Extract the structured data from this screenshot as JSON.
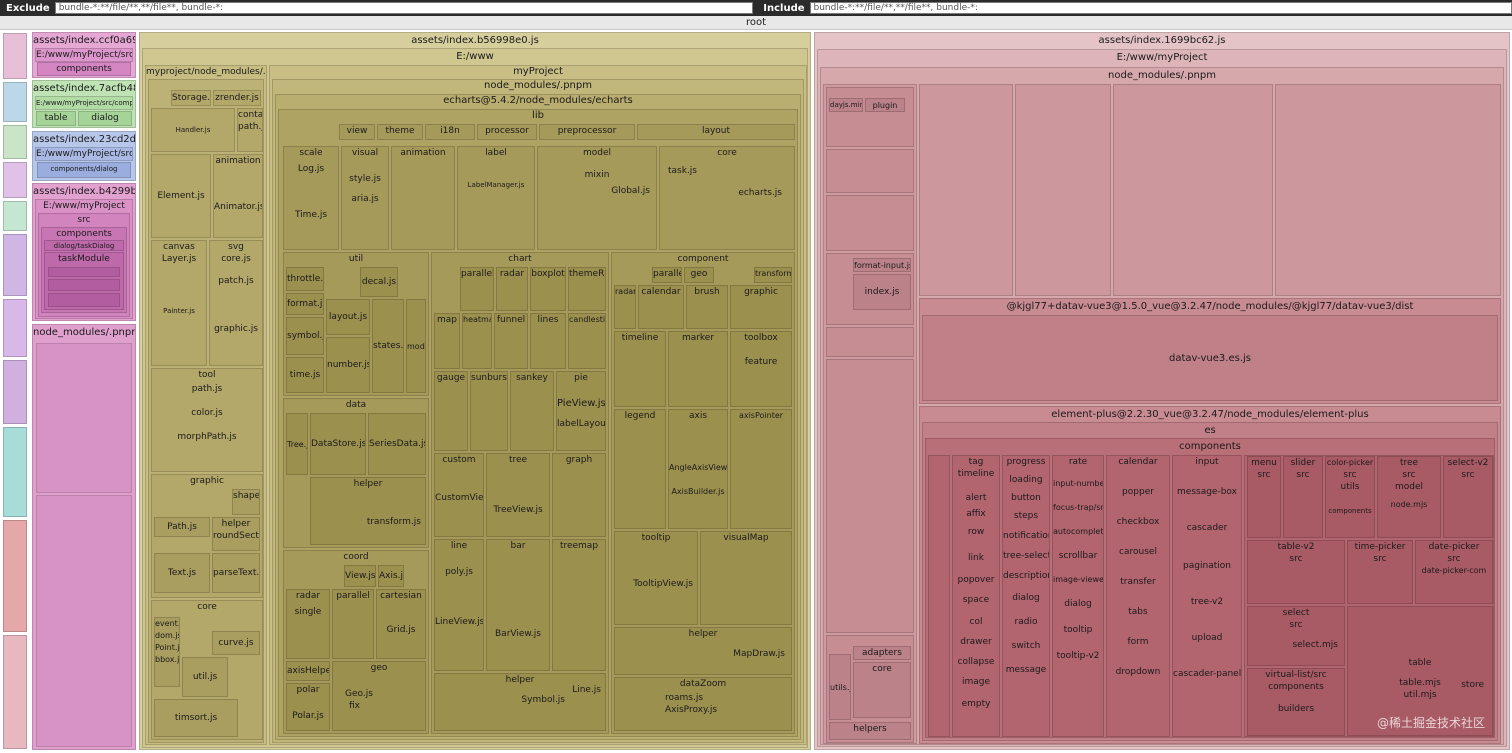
{
  "filters": {
    "exclude_label": "Exclude",
    "exclude_value": "bundle-*:**/file/**,**/file**, bundle-*:",
    "include_label": "Include",
    "include_value": "bundle-*:**/file/**,**/file**, bundle-*:"
  },
  "root_label": "root",
  "left_column": {
    "bundles": [
      {
        "name": "assets/index.ccf0a69d.js",
        "path": "E:/www/myProject/src",
        "children": [
          "components"
        ]
      },
      {
        "name": "assets/index.7acfb48d.js",
        "path": "E:/www/myProject/src/components",
        "children": [
          "table",
          "dialog"
        ]
      },
      {
        "name": "assets/index.23cd2dd2.js",
        "path": "E:/www/myProject/src",
        "children": [
          "components/dialog"
        ]
      },
      {
        "name": "assets/index.b4299b16.js",
        "path": "E:/www/myProject",
        "children": [
          "src",
          "components",
          "dialog/taskDialog",
          "taskModule"
        ]
      }
    ],
    "node_modules": "node_modules/.pnpm"
  },
  "middle": {
    "bundle": "assets/index.b56998e0.js",
    "path": "E:/www",
    "pnpm_left": "myproject/node_modules/.pnpm",
    "zrender": {
      "files": [
        "Storage.js",
        "zrender.js",
        "Handler.js",
        "contain",
        "path.js",
        "Element.js",
        "animation",
        "Animator.js",
        "canvas",
        "svg",
        "Layer.js",
        "core.js",
        "patch.js",
        "Painter.js",
        "graphic.js",
        "tool",
        "path.js",
        "color.js",
        "morphPath.js",
        "graphic",
        "shape",
        "Path.js",
        "helper",
        "roundSector.js",
        "Text.js",
        "parseText.js",
        "core",
        "curve.js",
        "event.js",
        "dom.js",
        "Point.js",
        "bbox.js",
        "util.js",
        "timsort.js"
      ]
    },
    "project": "myProject",
    "pnpm": "node_modules/.pnpm",
    "echarts": "echarts@5.4.2/node_modules/echarts",
    "lib": "lib",
    "lib_top": [
      "view",
      "theme",
      "i18n",
      "processor",
      "preprocessor",
      "layout"
    ],
    "scale": {
      "title": "scale",
      "files": [
        "Log.js",
        "Time.js"
      ]
    },
    "visual": {
      "title": "visual",
      "files": [
        "style.js",
        "aria.js"
      ]
    },
    "animation": "animation",
    "label": {
      "title": "label",
      "files": [
        "LabelManager.js"
      ]
    },
    "model": {
      "title": "model",
      "files": [
        "mixin",
        "Global.js"
      ]
    },
    "core": {
      "title": "core",
      "files": [
        "task.js",
        "echarts.js"
      ]
    },
    "util": {
      "title": "util",
      "files": [
        "throttle.js",
        "decal.js",
        "format.js",
        "layout.js",
        "symbol.js",
        "states.js",
        "model.js",
        "number.js",
        "time.js"
      ]
    },
    "data": {
      "title": "data",
      "files": [
        "Tree.js",
        "DataStore.js",
        "SeriesData.js"
      ]
    },
    "helper_d": {
      "title": "helper",
      "files": [
        "transform.js"
      ]
    },
    "coord": {
      "title": "coord",
      "files": [
        "View.js",
        "Axis.js",
        "radar",
        "parallel",
        "cartesian",
        "single",
        "Grid.js",
        "axisHelper.js",
        "geo",
        "polar",
        "Geo.js",
        "fix",
        "Polar.js"
      ]
    },
    "chart": {
      "title": "chart",
      "groups": [
        "parallel",
        "radar",
        "boxplot",
        "themeRiver",
        "map",
        "heatmap",
        "funnel",
        "lines",
        "candlestick",
        "gauge",
        "sunburst",
        "sankey",
        "pie",
        "custom",
        "tree",
        "graph",
        "line",
        "bar",
        "treemap",
        "helper"
      ],
      "files": [
        "PieView.js",
        "labelLayout.js",
        "CustomView.js",
        "TreeView.js",
        "poly.js",
        "LineView.js",
        "BarView.js",
        "Symbol.js",
        "Line.js"
      ]
    },
    "component": {
      "title": "component",
      "groups": [
        "parallel",
        "geo",
        "transform",
        "radar",
        "calendar",
        "brush",
        "graphic",
        "timeline",
        "marker",
        "toolbox",
        "feature",
        "legend",
        "axis",
        "axisPointer",
        "tooltip",
        "visualMap",
        "helper",
        "dataZoom"
      ],
      "files": [
        "AngleAxisView.js",
        "AxisBuilder.js",
        "TooltipView.js",
        "MapDraw.js",
        "roams.js",
        "AxisProxy.js"
      ]
    }
  },
  "right": {
    "bundle": "assets/index.1699bc62.js",
    "path": "E:/www/myProject",
    "pnpm": "node_modules/.pnpm",
    "dayjs": [
      "dayjs.min.js",
      "plugin"
    ],
    "misc": [
      "format-input.js",
      "index.js",
      "utils.js",
      "core",
      "adapters",
      "helpers"
    ],
    "datav_path": "@kjgl77+datav-vue3@1.5.0_vue@3.2.47/node_modules/@kjgl77/datav-vue3/dist",
    "datav_file": "datav-vue3.es.js",
    "ep_path": "element-plus@2.2.30_vue@3.2.47/node_modules/element-plus",
    "es": "es",
    "components": "components",
    "ep_cols": [
      [
        "tag",
        "timeline",
        "alert",
        "affix",
        "row",
        "link",
        "popover",
        "space",
        "col",
        "drawer",
        "collapse",
        "image",
        "empty"
      ],
      [
        "progress",
        "loading",
        "button",
        "steps",
        "notification",
        "tree-select",
        "descriptions",
        "dialog",
        "radio",
        "switch",
        "message"
      ],
      [
        "rate",
        "input-number",
        "focus-trap/src",
        "autocomplete",
        "scrollbar",
        "image-viewer",
        "dialog",
        "tooltip",
        "tooltip-v2"
      ],
      [
        "calendar",
        "popper",
        "checkbox",
        "carousel",
        "transfer",
        "tabs",
        "form",
        "dropdown"
      ],
      [
        "input",
        "message-box",
        "cascader",
        "pagination",
        "tree-v2",
        "upload",
        "cascader-panel"
      ],
      [
        "menu",
        "slider",
        "color-picker",
        "tree",
        "select-v2",
        "table-v2",
        "time-picker",
        "date-picker",
        "select",
        "table",
        "virtual-list/src",
        "builders"
      ],
      [
        "src",
        "utils",
        "components",
        "model",
        "node.mjs",
        "date-picker-com",
        "select.mjs",
        "table.mjs",
        "util.mjs",
        "store"
      ]
    ],
    "watermark": "@稀土掘金技术社区"
  },
  "colors": {
    "left_pink": "#d9a3cf",
    "mid_olive": "#a59552",
    "mid_light": "#d6ce9c",
    "right_rose": "#c98b92",
    "right_deep": "#b96b74"
  }
}
